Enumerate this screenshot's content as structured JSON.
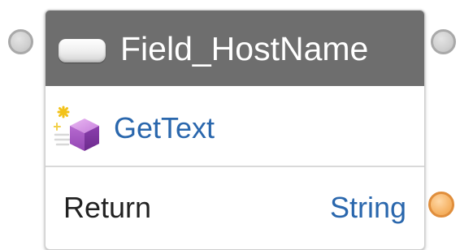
{
  "node": {
    "title": "Field_HostName",
    "header_icon": "toggle-switch-icon",
    "method": {
      "label": "GetText",
      "icon": "method-cube-icon"
    },
    "return": {
      "label": "Return",
      "type": "String"
    }
  },
  "colors": {
    "header_background": "#6e6e6e",
    "header_text": "#ffffff",
    "method_text": "#2a67ad",
    "return_type_text": "#2a67ad",
    "flow_port": "#cfcfcf",
    "data_port": "#f6b467"
  }
}
